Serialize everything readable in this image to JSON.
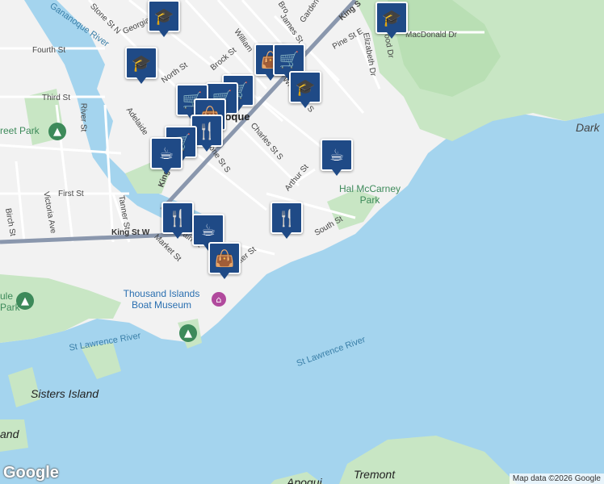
{
  "labels": {
    "stone_st_n": "Stone St N",
    "georgiana_st": "Georgiana St",
    "broad": "Bro",
    "garden": "Garden S",
    "james_st": "James St",
    "king_st_e": "King S",
    "gananoque_river": "Gananoque River",
    "fourth_st": "Fourth St",
    "william": "William",
    "north_st": "North St",
    "church": "Church St",
    "brock_st": "Brock St",
    "pine_st_e": "Pine St E",
    "elizabeth_dr": "Elizabeth Dr",
    "wood_dr": "wood Dr",
    "macdonald_dr": "MacDonald Dr",
    "third_st": "Third St",
    "river_st": "River St",
    "william_st_s": "William St S",
    "gananoque_town": "Gananoque",
    "adelaide": "Adelaide",
    "charles_st_s": "Charles St S",
    "street_park": "reet Park",
    "dark": "Dark",
    "stone_st_s": "Stone St S",
    "king_st": "King St",
    "arthur_st": "Arthur St",
    "first_st": "First St",
    "victoria_ave": "Victoria Ave",
    "tanner_st": "Tanner St",
    "birch_st": "Birch St",
    "hal_mccarney_park": "Hal McCarney Park",
    "south_st": "South St",
    "king_st_w": "King St W",
    "market_st": "Market St",
    "main_st": "ain St",
    "water_st": "Water St",
    "thousand_islands": "Thousand Islands Boat Museum",
    "ule_park": "ule Park",
    "st_lawrence_river_1": "St Lawrence River",
    "st_lawrence_river_2": "St Lawrence River",
    "sisters_island": "Sisters Island",
    "and": "and",
    "tremont": "Tremont",
    "aposqui": "Apoqui"
  },
  "attribution": "Map data ©2026 Google",
  "logo": "Google",
  "pins": [
    {
      "name": "school-icon",
      "glyph": "🎓"
    },
    {
      "name": "school-icon",
      "glyph": "🎓"
    },
    {
      "name": "shopping-icon",
      "glyph": "🛒"
    },
    {
      "name": "school-icon",
      "glyph": "🎓"
    },
    {
      "name": "cart-icon",
      "glyph": "🛒"
    },
    {
      "name": "bag-icon",
      "glyph": "👜"
    },
    {
      "name": "restaurant-icon",
      "glyph": "🍴"
    },
    {
      "name": "cafe-icon",
      "glyph": "☕"
    },
    {
      "name": "cafe-icon",
      "glyph": "☕"
    },
    {
      "name": "restaurant-icon",
      "glyph": "🍴"
    },
    {
      "name": "restaurant-icon",
      "glyph": "🍴"
    },
    {
      "name": "cafe-icon",
      "glyph": "☕"
    },
    {
      "name": "bag-icon",
      "glyph": "👜"
    }
  ],
  "colors": {
    "water": "#a4d4ee",
    "land": "#f2f2f2",
    "park": "#c8e6c4",
    "pin": "#1f4a86"
  }
}
